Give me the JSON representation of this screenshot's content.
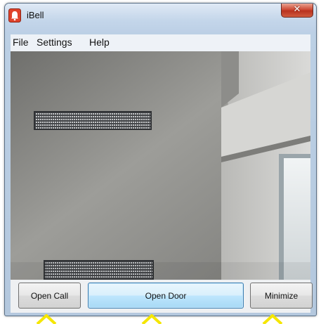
{
  "window": {
    "title": "iBell",
    "close_glyph": "✕"
  },
  "menu": {
    "items": [
      "File",
      "Settings",
      "Help"
    ]
  },
  "buttons": {
    "open_call": "Open Call",
    "open_door": "Open Door",
    "minimize": "Minimize"
  },
  "icons": {
    "app": "bell-app-icon",
    "close": "close-icon",
    "pointer": "arrow-pointer-icon"
  },
  "colors": {
    "pointer_yellow": "#f5e600",
    "close_red": "#c8402a",
    "primary_button_blue": "#bee6fd"
  }
}
